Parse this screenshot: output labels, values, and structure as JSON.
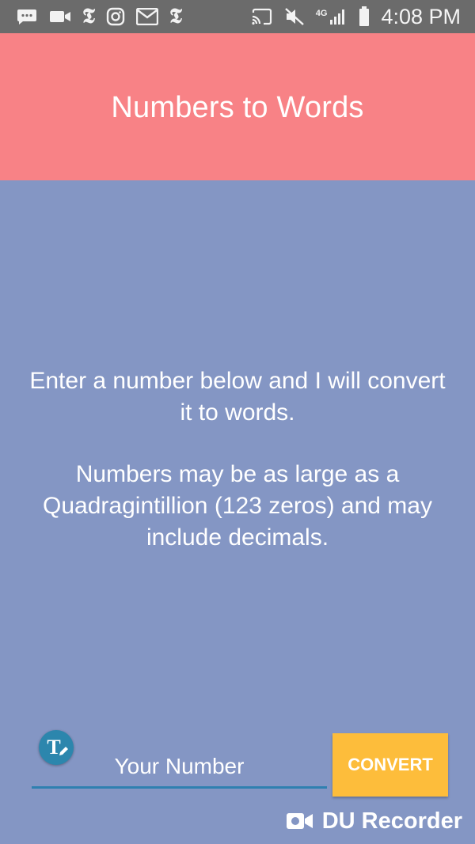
{
  "status_bar": {
    "time": "4:08 PM",
    "network": "4G",
    "left_icons": [
      "chat-bubble-icon",
      "video-camera-icon",
      "nyt-icon",
      "instagram-icon",
      "gmail-icon",
      "nyt-icon"
    ],
    "nyt_glyph": "𝕿",
    "right_icons": [
      "cast-icon",
      "mute-icon",
      "lte-signal-icon",
      "signal-bars-icon",
      "battery-icon"
    ]
  },
  "app_bar": {
    "title": "Numbers to Words"
  },
  "intro": {
    "line1": "Enter a number below and I will convert it to words.",
    "line2": "Numbers may be as large as a Quadragintillion (123 zeros) and may include decimals."
  },
  "input": {
    "placeholder": "Your Number",
    "value": ""
  },
  "fab": {
    "glyph": "T"
  },
  "convert": {
    "label": "CONVERT"
  },
  "watermark": {
    "text": "DU Recorder"
  },
  "colors": {
    "app_bar": "#f88286",
    "background": "#8496c4",
    "button": "#fdbd3b",
    "underline": "#2f80b0",
    "status_bar": "#6b6b6b"
  }
}
